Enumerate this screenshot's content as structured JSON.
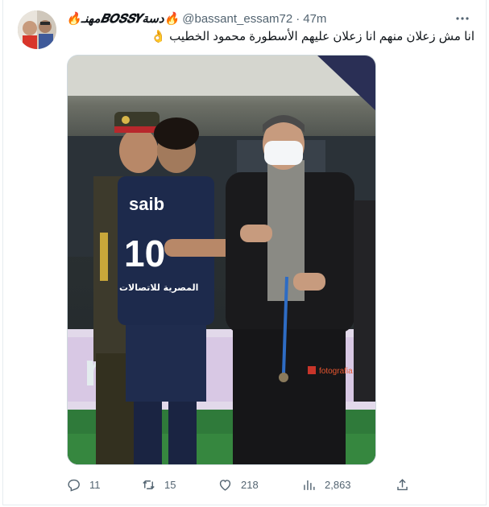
{
  "tweet": {
    "display_name": "🔥مهنـ𝑩𝑶𝑺𝑺𝒀دسة🔥",
    "handle": "@bassant_essam72",
    "separator": "·",
    "time": "47m",
    "text": "انا مش زعلان منهم انا زعلان عليهم الأسطورة محمود الخطيب 👌",
    "image": {
      "shirt_brand": "saib",
      "shirt_number": "10",
      "shirt_sponsor": "المصرية للاتصالات",
      "watermark": "fotografia"
    },
    "stats": {
      "replies": "11",
      "retweets": "15",
      "likes": "218",
      "views": "2,863"
    }
  },
  "icons": {
    "more": "more-dots-icon",
    "reply": "reply-icon",
    "retweet": "retweet-icon",
    "like": "heart-icon",
    "views": "views-chart-icon",
    "share": "share-icon"
  },
  "colors": {
    "text": "#0f1419",
    "muted": "#536471",
    "border": "#e6ecf0"
  }
}
